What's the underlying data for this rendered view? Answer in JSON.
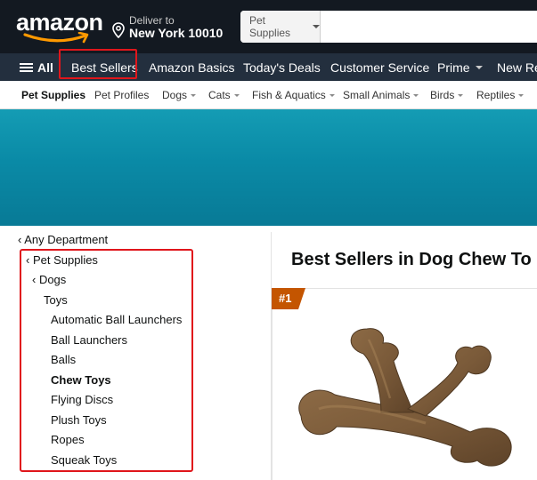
{
  "header": {
    "logo_text": "amazon",
    "deliver_to_label": "Deliver to",
    "deliver_to_location": "New York 10010",
    "search_category": "Pet Supplies"
  },
  "nav": {
    "all_label": "All",
    "items": [
      "Best Sellers",
      "Amazon Basics",
      "Today's Deals",
      "Customer Service",
      "Prime",
      "New Rel"
    ]
  },
  "subnav": {
    "items": [
      "Pet Supplies",
      "Pet Profiles",
      "Dogs",
      "Cats",
      "Fish & Aquatics",
      "Small Animals",
      "Birds",
      "Reptiles"
    ]
  },
  "sidebar": {
    "any_department": "‹ Any Department",
    "pet_supplies": "‹ Pet Supplies",
    "dogs": "‹ Dogs",
    "toys": "Toys",
    "children": [
      "Automatic Ball Launchers",
      "Ball Launchers",
      "Balls",
      "Chew Toys",
      "Flying Discs",
      "Plush Toys",
      "Ropes",
      "Squeak Toys"
    ],
    "selected": "Chew Toys"
  },
  "main": {
    "title": "Best Sellers in Dog Chew To",
    "rank_badge": "#1"
  },
  "colors": {
    "header_bg": "#131921",
    "nav_bg": "#232f3e",
    "highlight": "#e0161b",
    "badge": "#c45500",
    "banner": "#0a8aa6"
  },
  "icons": {
    "location": "location-pin-icon",
    "menu": "hamburger-menu-icon",
    "logo_smile": "amazon-smile-icon"
  }
}
